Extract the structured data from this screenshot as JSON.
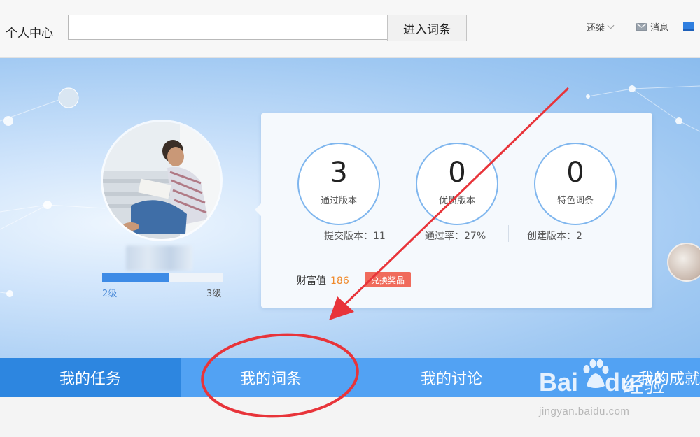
{
  "topbar": {
    "title": "个人中心",
    "search": {
      "value": "",
      "placeholder": ""
    },
    "enter_button": "进入词条",
    "user_menu": "还桀",
    "messages": "消息"
  },
  "profile": {
    "level_current": "2级",
    "level_next": "3级",
    "level_progress": 0.56
  },
  "stats": [
    {
      "value": "3",
      "label": "通过版本"
    },
    {
      "value": "0",
      "label": "优质版本"
    },
    {
      "value": "0",
      "label": "特色词条"
    }
  ],
  "meta": {
    "submitted": "提交版本：11",
    "pass_rate": "通过率：27%",
    "created": "创建版本：2"
  },
  "wealth": {
    "label": "财富值",
    "value": "186",
    "redeem_button": "兑换奖品"
  },
  "tabs": [
    {
      "label": "我的任务",
      "active": true
    },
    {
      "label": "我的词条",
      "active": false
    },
    {
      "label": "我的讨论",
      "active": false
    },
    {
      "label": "我的成就",
      "active": false
    }
  ],
  "watermark": {
    "brand": "Bai",
    "brand2": "du",
    "product": "经验",
    "url": "jingyan.baidu.com"
  },
  "colors": {
    "tab_bar": "#52a2f3",
    "tab_active": "#2d86e0",
    "annotation": "#e8343a",
    "wealth_value": "#f08a2b",
    "redeem_button": "#f06b5c"
  }
}
